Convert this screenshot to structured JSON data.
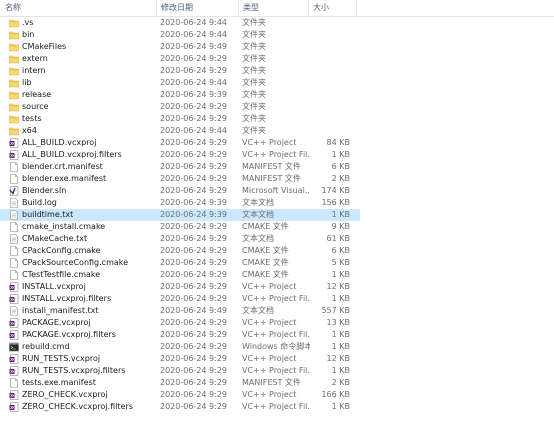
{
  "columns": {
    "name": "名称",
    "date": "修改日期",
    "type": "类型",
    "size": "大小"
  },
  "selected_index": 16,
  "files": [
    {
      "name": ".vs",
      "date": "2020-06-24 9:44",
      "type": "文件夹",
      "size": "",
      "icon": "folder-icon"
    },
    {
      "name": "bin",
      "date": "2020-06-24 9:44",
      "type": "文件夹",
      "size": "",
      "icon": "folder-icon"
    },
    {
      "name": "CMakeFiles",
      "date": "2020-06-24 9:49",
      "type": "文件夹",
      "size": "",
      "icon": "folder-icon"
    },
    {
      "name": "extern",
      "date": "2020-06-24 9:29",
      "type": "文件夹",
      "size": "",
      "icon": "folder-icon"
    },
    {
      "name": "intern",
      "date": "2020-06-24 9:29",
      "type": "文件夹",
      "size": "",
      "icon": "folder-icon"
    },
    {
      "name": "lib",
      "date": "2020-06-24 9:44",
      "type": "文件夹",
      "size": "",
      "icon": "folder-icon"
    },
    {
      "name": "release",
      "date": "2020-06-24 9:39",
      "type": "文件夹",
      "size": "",
      "icon": "folder-icon"
    },
    {
      "name": "source",
      "date": "2020-06-24 9:29",
      "type": "文件夹",
      "size": "",
      "icon": "folder-icon"
    },
    {
      "name": "tests",
      "date": "2020-06-24 9:29",
      "type": "文件夹",
      "size": "",
      "icon": "folder-icon"
    },
    {
      "name": "x64",
      "date": "2020-06-24 9:44",
      "type": "文件夹",
      "size": "",
      "icon": "folder-icon"
    },
    {
      "name": "ALL_BUILD.vcxproj",
      "date": "2020-06-24 9:29",
      "type": "VC++ Project",
      "size": "84 KB",
      "icon": "vcxproj-icon"
    },
    {
      "name": "ALL_BUILD.vcxproj.filters",
      "date": "2020-06-24 9:29",
      "type": "VC++ Project Fil...",
      "size": "1 KB",
      "icon": "vcxproj-icon"
    },
    {
      "name": "blender.crt.manifest",
      "date": "2020-06-24 9:29",
      "type": "MANIFEST 文件",
      "size": "6 KB",
      "icon": "document-icon"
    },
    {
      "name": "blender.exe.manifest",
      "date": "2020-06-24 9:29",
      "type": "MANIFEST 文件",
      "size": "2 KB",
      "icon": "document-icon"
    },
    {
      "name": "Blender.sln",
      "date": "2020-06-24 9:29",
      "type": "Microsoft Visual...",
      "size": "174 KB",
      "icon": "solution-icon"
    },
    {
      "name": "Build.log",
      "date": "2020-06-24 9:39",
      "type": "文本文档",
      "size": "156 KB",
      "icon": "text-file-icon"
    },
    {
      "name": "buildtime.txt",
      "date": "2020-06-24 9:39",
      "type": "文本文档",
      "size": "1 KB",
      "icon": "text-file-icon"
    },
    {
      "name": "cmake_install.cmake",
      "date": "2020-06-24 9:29",
      "type": "CMAKE 文件",
      "size": "9 KB",
      "icon": "document-icon"
    },
    {
      "name": "CMakeCache.txt",
      "date": "2020-06-24 9:29",
      "type": "文本文档",
      "size": "61 KB",
      "icon": "text-file-icon"
    },
    {
      "name": "CPackConfig.cmake",
      "date": "2020-06-24 9:29",
      "type": "CMAKE 文件",
      "size": "6 KB",
      "icon": "document-icon"
    },
    {
      "name": "CPackSourceConfig.cmake",
      "date": "2020-06-24 9:29",
      "type": "CMAKE 文件",
      "size": "5 KB",
      "icon": "document-icon"
    },
    {
      "name": "CTestTestfile.cmake",
      "date": "2020-06-24 9:29",
      "type": "CMAKE 文件",
      "size": "1 KB",
      "icon": "document-icon"
    },
    {
      "name": "INSTALL.vcxproj",
      "date": "2020-06-24 9:29",
      "type": "VC++ Project",
      "size": "12 KB",
      "icon": "vcxproj-icon"
    },
    {
      "name": "INSTALL.vcxproj.filters",
      "date": "2020-06-24 9:29",
      "type": "VC++ Project Fil...",
      "size": "1 KB",
      "icon": "vcxproj-icon"
    },
    {
      "name": "install_manifest.txt",
      "date": "2020-06-24 9:49",
      "type": "文本文档",
      "size": "557 KB",
      "icon": "text-file-icon"
    },
    {
      "name": "PACKAGE.vcxproj",
      "date": "2020-06-24 9:29",
      "type": "VC++ Project",
      "size": "13 KB",
      "icon": "vcxproj-icon"
    },
    {
      "name": "PACKAGE.vcxproj.filters",
      "date": "2020-06-24 9:29",
      "type": "VC++ Project Fil...",
      "size": "1 KB",
      "icon": "vcxproj-icon"
    },
    {
      "name": "rebuild.cmd",
      "date": "2020-06-24 9:29",
      "type": "Windows 命令脚本",
      "size": "1 KB",
      "icon": "cmd-script-icon"
    },
    {
      "name": "RUN_TESTS.vcxproj",
      "date": "2020-06-24 9:29",
      "type": "VC++ Project",
      "size": "12 KB",
      "icon": "vcxproj-icon"
    },
    {
      "name": "RUN_TESTS.vcxproj.filters",
      "date": "2020-06-24 9:29",
      "type": "VC++ Project Fil...",
      "size": "1 KB",
      "icon": "vcxproj-icon"
    },
    {
      "name": "tests.exe.manifest",
      "date": "2020-06-24 9:29",
      "type": "MANIFEST 文件",
      "size": "2 KB",
      "icon": "document-icon"
    },
    {
      "name": "ZERO_CHECK.vcxproj",
      "date": "2020-06-24 9:29",
      "type": "VC++ Project",
      "size": "166 KB",
      "icon": "vcxproj-icon"
    },
    {
      "name": "ZERO_CHECK.vcxproj.filters",
      "date": "2020-06-24 9:29",
      "type": "VC++ Project Fil...",
      "size": "1 KB",
      "icon": "vcxproj-icon"
    }
  ],
  "colors": {
    "folder": "#f8d775",
    "folder_dark": "#e0b03c",
    "vcxproj": "#68217a",
    "selection": "#cce8ff",
    "header_text": "#4c607a"
  }
}
